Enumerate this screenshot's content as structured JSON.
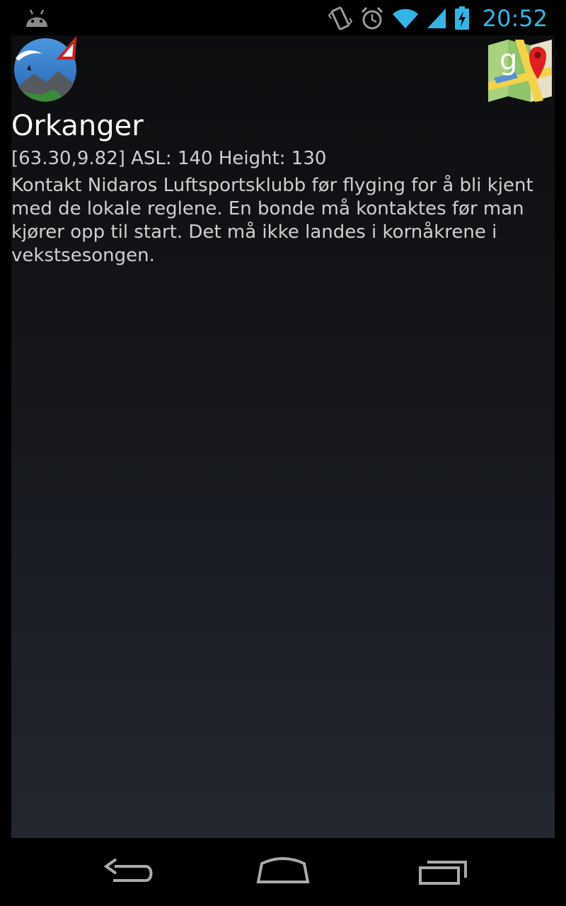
{
  "status_bar": {
    "time": "20:52",
    "icons": [
      "android-debug-icon",
      "vibrate-icon",
      "alarm-icon",
      "wifi-icon",
      "signal-icon",
      "battery-charging-icon"
    ]
  },
  "header": {
    "app_icon": "paragliding-app-icon",
    "maps_button": "google-maps-icon"
  },
  "site": {
    "name": "Orkanger",
    "info": "[63.30,9.82] ASL: 140 Height: 130",
    "description": "Kontakt Nidaros Luftsportsklubb før flyging for å bli kjent med de lokale reglene. En bonde må kontaktes før man kjører opp til start. Det må ikke landes i kornåkrene i vekstsesongen."
  },
  "nav_bar": {
    "buttons": [
      "back-icon",
      "home-icon",
      "recents-icon"
    ]
  },
  "colors": {
    "accent": "#33b5e5",
    "text_primary": "#ffffff",
    "text_secondary": "#cfcfcf"
  }
}
